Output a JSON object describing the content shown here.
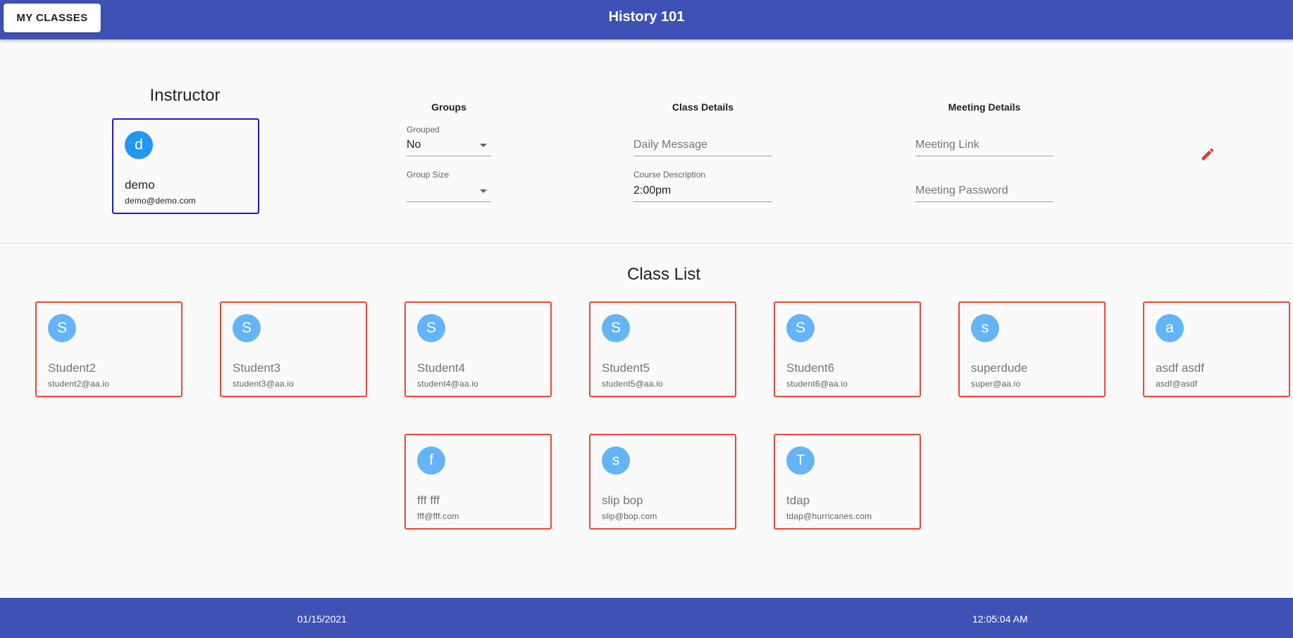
{
  "header": {
    "my_classes_label": "MY CLASSES",
    "title": "History 101"
  },
  "instructor": {
    "heading": "Instructor",
    "initial": "d",
    "name": "demo",
    "email": "demo@demo.com"
  },
  "groups": {
    "heading": "Groups",
    "grouped_label": "Grouped",
    "grouped_value": "No",
    "group_size_label": "Group Size",
    "group_size_value": ""
  },
  "class_details": {
    "heading": "Class Details",
    "daily_message_placeholder": "Daily Message",
    "course_description_label": "Course Description",
    "course_description_value": "2:00pm"
  },
  "meeting_details": {
    "heading": "Meeting Details",
    "meeting_link_placeholder": "Meeting Link",
    "meeting_password_placeholder": "Meeting Password"
  },
  "edit_icon": "pencil-icon",
  "class_list": {
    "heading": "Class List",
    "students": [
      {
        "initial": "S",
        "name": "Student2",
        "email": "student2@aa.io"
      },
      {
        "initial": "S",
        "name": "Student3",
        "email": "student3@aa.io"
      },
      {
        "initial": "S",
        "name": "Student4",
        "email": "student4@aa.io"
      },
      {
        "initial": "S",
        "name": "Student5",
        "email": "student5@aa.io"
      },
      {
        "initial": "S",
        "name": "Student6",
        "email": "student6@aa.io"
      },
      {
        "initial": "s",
        "name": "superdude",
        "email": "super@aa.io"
      },
      {
        "initial": "a",
        "name": "asdf asdf",
        "email": "asdf@asdf"
      },
      {
        "initial": "f",
        "name": "fff fff",
        "email": "fff@fff.com"
      },
      {
        "initial": "s",
        "name": "slip bop",
        "email": "slip@bop.com"
      },
      {
        "initial": "T",
        "name": "tdap",
        "email": "tdap@hurricanes.com"
      }
    ]
  },
  "footer": {
    "date": "01/15/2021",
    "time": "12:05:04 AM"
  },
  "colors": {
    "appbar": "#3f51b5",
    "instructor_border": "#1a1acc",
    "student_border": "#f44336",
    "avatar": "#64b5f6",
    "edit_icon": "#e53935"
  }
}
